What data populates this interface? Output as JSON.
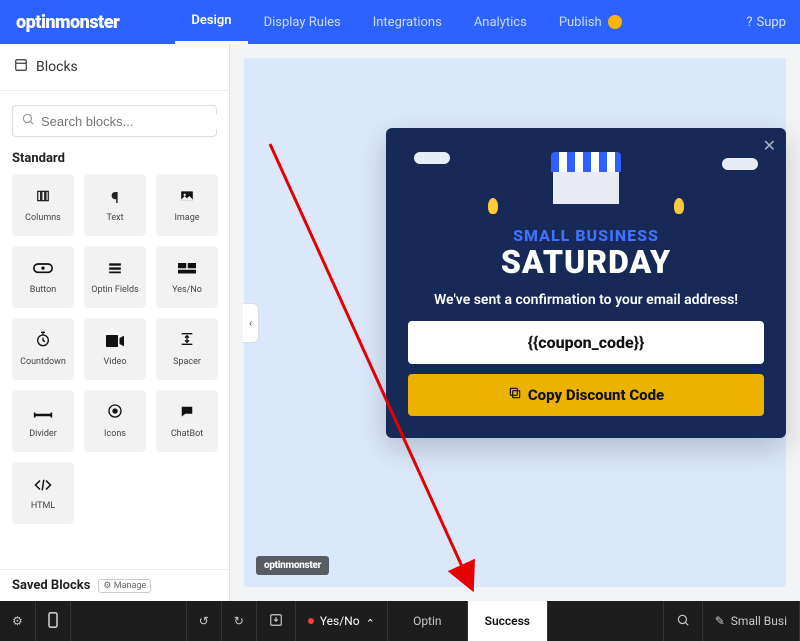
{
  "brand": "optinmonster",
  "nav": {
    "tabs": [
      "Design",
      "Display Rules",
      "Integrations",
      "Analytics",
      "Publish"
    ],
    "active": 0,
    "help": "Supp"
  },
  "sidebar": {
    "title": "Blocks",
    "search_placeholder": "Search blocks...",
    "section": "Standard",
    "blocks": [
      {
        "label": "Columns",
        "icon": "columns"
      },
      {
        "label": "Text",
        "icon": "text"
      },
      {
        "label": "Image",
        "icon": "image"
      },
      {
        "label": "Button",
        "icon": "button"
      },
      {
        "label": "Optin Fields",
        "icon": "fields"
      },
      {
        "label": "Yes/No",
        "icon": "yesno"
      },
      {
        "label": "Countdown",
        "icon": "clock"
      },
      {
        "label": "Video",
        "icon": "video"
      },
      {
        "label": "Spacer",
        "icon": "spacer"
      },
      {
        "label": "Divider",
        "icon": "divider"
      },
      {
        "label": "Icons",
        "icon": "icons"
      },
      {
        "label": "ChatBot",
        "icon": "chatbot"
      },
      {
        "label": "HTML",
        "icon": "html"
      }
    ],
    "saved_title": "Saved Blocks",
    "saved_btn": "Manage"
  },
  "popup": {
    "eyebrow": "SMALL BUSINESS",
    "title": "SATURDAY",
    "confirmation": "We've sent a confirmation to your email address!",
    "code_placeholder": "{{coupon_code}}",
    "copy_label": "Copy Discount Code"
  },
  "watermark": "optinmonster",
  "footer": {
    "steps": [
      "Yes/No",
      "Optin",
      "Success"
    ],
    "active_step": 2,
    "campaign": "Small Busi"
  }
}
